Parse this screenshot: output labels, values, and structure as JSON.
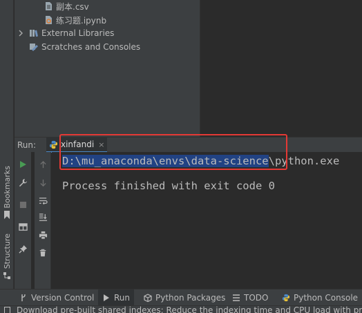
{
  "project_tree": {
    "items": [
      {
        "label": "副本.csv",
        "icon": "csv-file-icon"
      },
      {
        "label": "练习题.ipynb",
        "icon": "notebook-file-icon"
      },
      {
        "label": "External Libraries",
        "icon": "library-icon"
      },
      {
        "label": "Scratches and Consoles",
        "icon": "scratches-icon"
      }
    ]
  },
  "left_strip": {
    "bookmarks_label": "Bookmarks",
    "structure_label": "Structure"
  },
  "run_window": {
    "label": "Run:",
    "tab_label": "xinfandi",
    "tab_close": "×"
  },
  "console": {
    "path_selected": "D:\\mu_anaconda\\envs\\data-science",
    "path_rest": "\\python.exe",
    "exit_message": "Process finished with exit code 0"
  },
  "bottom_bar": {
    "tabs": [
      {
        "label": "Version Control",
        "icon": "version-control-icon"
      },
      {
        "label": "Run",
        "icon": "run-icon"
      },
      {
        "label": "Python Packages",
        "icon": "python-packages-icon"
      },
      {
        "label": "TODO",
        "icon": "todo-icon"
      },
      {
        "label": "Python Console",
        "icon": "python-console-icon"
      }
    ]
  },
  "status_bar": {
    "message": "Download pre-built shared indexes: Reduce the indexing time and CPU load with pre-"
  },
  "colors": {
    "highlight_box": "#e53935",
    "selection": "#214283",
    "run_green": "#499c54"
  }
}
